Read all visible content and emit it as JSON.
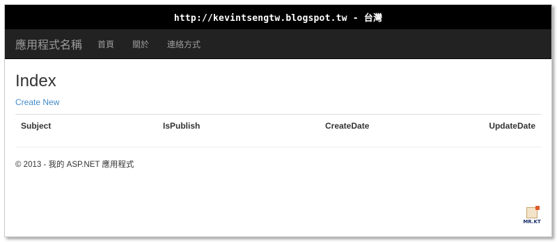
{
  "url_bar": {
    "text": "http://kevintsengtw.blogspot.tw - 台灣"
  },
  "navbar": {
    "brand": "應用程式名稱",
    "links": [
      "首頁",
      "關於",
      "連絡方式"
    ]
  },
  "main": {
    "title": "Index",
    "create_link": "Create New",
    "table": {
      "columns": [
        "Subject",
        "IsPublish",
        "CreateDate",
        "UpdateDate"
      ],
      "rows": []
    }
  },
  "footer": {
    "text": "© 2013 - 我的 ASP.NET 應用程式"
  },
  "watermark": {
    "text": "MR.KT"
  }
}
